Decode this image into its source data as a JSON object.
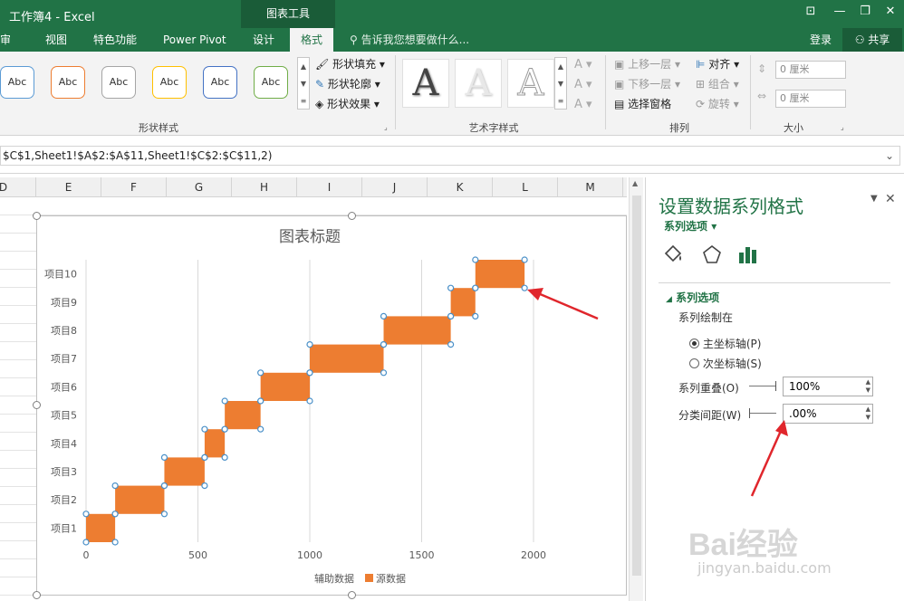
{
  "titlebar": {
    "title": "工作簿4 - Excel",
    "context_tab": "图表工具",
    "window_icons": [
      "⊡",
      "—",
      "❐",
      "✕"
    ]
  },
  "tabs": [
    {
      "label": "审阅",
      "active": false
    },
    {
      "label": "视图",
      "active": false
    },
    {
      "label": "特色功能",
      "active": false
    },
    {
      "label": "Power Pivot",
      "active": false
    },
    {
      "label": "设计",
      "active": false
    },
    {
      "label": "格式",
      "active": true
    }
  ],
  "tellme": "告诉我您想要做什么...",
  "login": "登录",
  "share": "共享",
  "ribbon": {
    "shape_styles": {
      "label": "形状样式",
      "swatch_text": "Abc",
      "swatch_borders": [
        "#5b9bd5",
        "#ed7d31",
        "#a5a5a5",
        "#ffc000",
        "#4472c4",
        "#70ad47"
      ],
      "fill": "形状填充",
      "outline": "形状轮廓",
      "effect": "形状效果"
    },
    "wordart": {
      "label": "艺术字样式",
      "letter": "A"
    },
    "arrange": {
      "label": "排列",
      "bring_forward": "上移一层",
      "send_backward": "下移一层",
      "selection_pane": "选择窗格",
      "align": "对齐",
      "group": "组合",
      "rotate": "旋转"
    },
    "size": {
      "label": "大小",
      "height": "0 厘米",
      "width": "0 厘米"
    }
  },
  "formula": "$C$1,Sheet1!$A$2:$A$11,Sheet1!$C$2:$C$11,2)",
  "columns": [
    "D",
    "E",
    "F",
    "G",
    "H",
    "I",
    "J",
    "K",
    "L",
    "M"
  ],
  "chart_data": {
    "type": "bar",
    "title": "图表标题",
    "categories": [
      "项目1",
      "项目2",
      "项目3",
      "项目4",
      "项目5",
      "项目6",
      "项目7",
      "项目8",
      "项目9",
      "项目10"
    ],
    "series": [
      {
        "name": "辅助数据",
        "values": [
          0,
          130,
          350,
          530,
          620,
          780,
          1000,
          1330,
          1630,
          1740
        ],
        "color": "none"
      },
      {
        "name": "源数据",
        "values": [
          130,
          220,
          180,
          90,
          160,
          220,
          330,
          300,
          110,
          220
        ],
        "color": "#ed7d31"
      }
    ],
    "stacked": true,
    "orientation": "horizontal",
    "xlim": [
      0,
      2000
    ],
    "xticks": [
      0,
      500,
      1000,
      1500,
      2000
    ],
    "legend_placement": "bottom",
    "grid": true
  },
  "pane": {
    "title": "设置数据系列格式",
    "dropdown": "系列选项",
    "section": "系列选项",
    "plot_on": "系列绘制在",
    "primary_axis": "主坐标轴(P)",
    "secondary_axis": "次坐标轴(S)",
    "overlap_label": "系列重叠(O)",
    "overlap_value": "100%",
    "gap_label": "分类间距(W)",
    "gap_value": ".00%"
  },
  "watermark": {
    "brand": "Bai经验",
    "url": "jingyan.baidu.com"
  }
}
